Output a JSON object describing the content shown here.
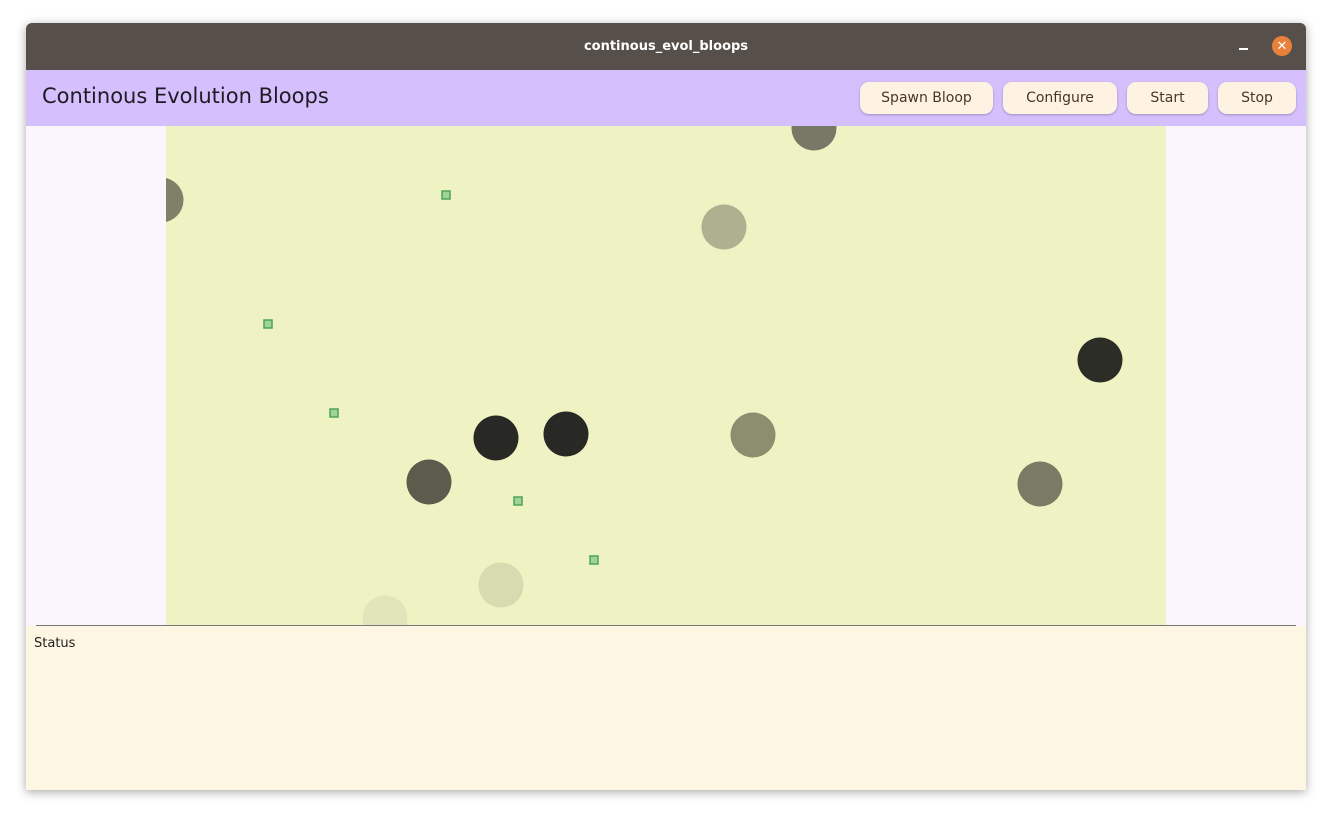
{
  "window": {
    "title": "continous_evol_bloops",
    "minimize_icon": "minimize-icon",
    "close_icon": "close-icon",
    "close_glyph": "✕"
  },
  "appbar": {
    "title": "Continous Evolution Bloops",
    "buttons": {
      "spawn": "Spawn Bloop",
      "configure": "Configure",
      "start": "Start",
      "stop": "Stop"
    }
  },
  "status": {
    "label": "Status"
  },
  "colors": {
    "titlebar": "#574f4a",
    "appbar": "#d5bffc",
    "canvas": "#eff2c3",
    "button": "#fef3e3",
    "close": "#e9813a",
    "food": "#6bbf6a"
  }
}
